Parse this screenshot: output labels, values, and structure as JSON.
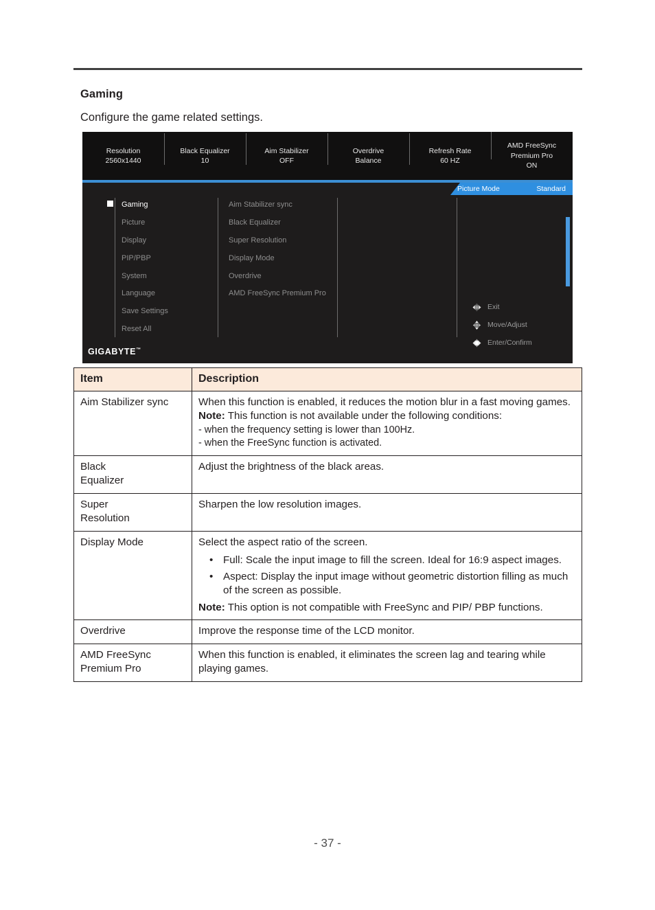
{
  "page": {
    "section_title": "Gaming",
    "section_subtitle": "Configure the game related settings.",
    "page_number": "- 37 -"
  },
  "osd": {
    "brand": "GIGABYTE",
    "brand_tm": "™",
    "top_bar": [
      {
        "label": "Resolution",
        "value": "2560x1440"
      },
      {
        "label": "Black Equalizer",
        "value": "10"
      },
      {
        "label": "Aim Stabilizer",
        "value": "OFF"
      },
      {
        "label": "Overdrive",
        "value": "Balance"
      },
      {
        "label": "Refresh Rate",
        "value": "60 HZ"
      },
      {
        "label": "AMD FreeSync\nPremium Pro",
        "value": "ON"
      }
    ],
    "top_bar_multiline": {
      "amd_line1": "AMD FreeSync",
      "amd_line2": "Premium Pro",
      "amd_value": "ON"
    },
    "picture_mode": {
      "label": "Picture Mode",
      "value": "Standard"
    },
    "menu_left": [
      {
        "label": "Gaming",
        "active": true
      },
      {
        "label": "Picture",
        "active": false
      },
      {
        "label": "Display",
        "active": false
      },
      {
        "label": "PIP/PBP",
        "active": false
      },
      {
        "label": "System",
        "active": false
      },
      {
        "label": "Language",
        "active": false
      },
      {
        "label": "Save Settings",
        "active": false
      },
      {
        "label": "Reset All",
        "active": false
      }
    ],
    "menu_mid": [
      {
        "label": "Aim Stabilizer sync"
      },
      {
        "label": "Black Equalizer"
      },
      {
        "label": "Super Resolution"
      },
      {
        "label": "Display Mode"
      },
      {
        "label": "Overdrive"
      },
      {
        "label": "AMD FreeSync Premium Pro"
      }
    ],
    "nav_hints": [
      {
        "label": "Exit",
        "icon": "joystick-left-right-icon"
      },
      {
        "label": "Move/Adjust",
        "icon": "joystick-up-down-icon"
      },
      {
        "label": "Enter/Confirm",
        "icon": "joystick-press-icon"
      }
    ],
    "colors": {
      "accent_blue": "#3c8fd4",
      "scrollbar_blue": "#4a9ae0",
      "panel_bg": "#1e1c1c",
      "topbar_bg": "#111010"
    }
  },
  "table": {
    "headers": {
      "item": "Item",
      "description": "Description"
    },
    "header_bg": "#fceadb",
    "rows": [
      {
        "item": "Aim Stabilizer sync",
        "desc_lines": [
          "When this function is enabled, it reduces the motion blur in a fast moving games."
        ],
        "note_label": "Note:",
        "note_text": " This function is not available under the following conditions:",
        "sub_lines": [
          "- when the frequency setting is lower than 100Hz.",
          "- when the FreeSync function is activated."
        ]
      },
      {
        "item": "Black Equalizer",
        "desc_lines": [
          "Adjust the brightness of the black areas."
        ]
      },
      {
        "item": "Super Resolution",
        "desc_lines": [
          "Sharpen the low resolution images."
        ]
      },
      {
        "item": "Display Mode",
        "desc_lines": [
          "Select the aspect ratio of the screen."
        ],
        "bullets": [
          "Full: Scale the input image to fill the screen. Ideal for 16:9 aspect images.",
          "Aspect: Display the input image without geometric distortion filling as much of the screen as possible."
        ],
        "note_label": "Note:",
        "note_text": " This option is not compatible with FreeSync and PIP/ PBP functions."
      },
      {
        "item": "Overdrive",
        "desc_lines": [
          "Improve the response time of the LCD monitor."
        ]
      },
      {
        "item": "AMD FreeSync Premium Pro",
        "desc_lines": [
          "When this function is enabled, it eliminates the screen lag and tearing while playing games."
        ]
      }
    ]
  }
}
